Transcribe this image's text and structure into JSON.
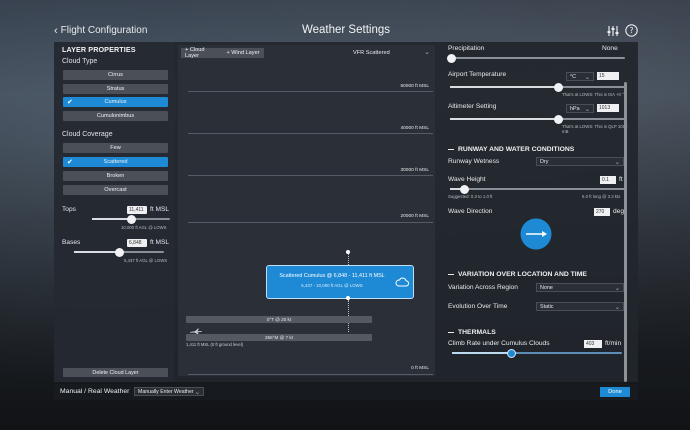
{
  "header": {
    "back_label": "Flight Configuration",
    "title": "Weather Settings"
  },
  "left_panel": {
    "section_title": "LAYER PROPERTIES",
    "cloud_type_label": "Cloud Type",
    "cloud_types": [
      {
        "label": "Cirrus",
        "active": false
      },
      {
        "label": "Stratus",
        "active": false
      },
      {
        "label": "Cumulus",
        "active": true
      },
      {
        "label": "Cumulonimbus",
        "active": false
      }
    ],
    "cloud_coverage_label": "Cloud Coverage",
    "coverages": [
      {
        "label": "Few",
        "active": false
      },
      {
        "label": "Scattered",
        "active": true
      },
      {
        "label": "Broken",
        "active": false
      },
      {
        "label": "Overcast",
        "active": false
      }
    ],
    "tops": {
      "label": "Tops",
      "value": "11,411",
      "unit": "ft MSL",
      "note": "10,000 ft AGL @ LOWS",
      "level_pct": 50
    },
    "bases": {
      "label": "Bases",
      "value": "6,848",
      "unit": "ft MSL",
      "note": "5,437 ft AGL @ LOWS",
      "level_pct": 50
    },
    "delete_label": "Delete Cloud Layer"
  },
  "center_panel": {
    "add_cloud_label": "+ Cloud Layer",
    "add_wind_label": "+ Wind Layer",
    "preset_label": "VFR Scattered",
    "altitudes": [
      "50000 ft MSL",
      "40000 ft MSL",
      "30000 ft MSL",
      "20000 ft MSL",
      "0 ft MSL"
    ],
    "cloud_layer": {
      "title": "Scattered Cumulus @ 6,848 - 11,411 ft MSL",
      "subtitle": "5,437 - 10,000 ft AGL @ LOWS"
    },
    "wind_layers": [
      "0°T @ 20 kt",
      "356°M @ 7 kt"
    ],
    "wind_note": "1,411 ft MSL (0 ft ground level)"
  },
  "right_panel": {
    "precipitation": {
      "label": "Precipitation",
      "value": "None",
      "level_pct": 0
    },
    "airport_temperature": {
      "label": "Airport Temperature",
      "unit_select": "°C",
      "value": "15",
      "note": "That's at LOWS: This is ISA +0 °C",
      "level_pct": 62
    },
    "altimeter": {
      "label": "Altimeter Setting",
      "unit_select": "hPa",
      "value": "1013",
      "note": "That's at LOWS: This is QLP 1013 mB",
      "level_pct": 62
    },
    "runway_header": "RUNWAY AND WATER CONDITIONS",
    "runway_wetness": {
      "label": "Runway Wetness",
      "value": "Dry"
    },
    "wave_height": {
      "label": "Wave Height",
      "value": "0.1",
      "unit": "ft",
      "note_left": "Suggested: 0.3 to 1.0 ft",
      "note_right": "6.0 ft long @ 3.3 kts",
      "level_pct": 5
    },
    "wave_direction": {
      "label": "Wave Direction",
      "value": "270",
      "unit": "deg"
    },
    "variation_header": "VARIATION OVER LOCATION AND TIME",
    "variation_region": {
      "label": "Variation Across Region",
      "value": "None"
    },
    "evolution_time": {
      "label": "Evolution Over Time",
      "value": "Static"
    },
    "thermals_header": "THERMALS",
    "climb_rate": {
      "label": "Climb Rate under Cumulus Clouds",
      "value": "403",
      "unit": "ft/min",
      "level_pct": 35
    }
  },
  "bottom_bar": {
    "mode_label": "Manual / Real Weather",
    "mode_value": "Manually Enter Weather",
    "done_label": "Done"
  },
  "colors": {
    "accent": "#1e8ad6",
    "panel": "#22262d",
    "button": "#4b5058"
  }
}
